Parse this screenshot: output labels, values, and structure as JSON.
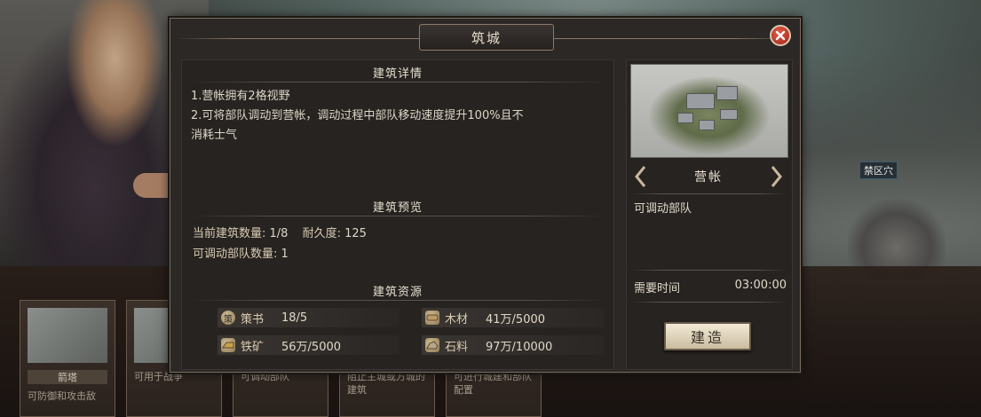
{
  "dialog": {
    "title": "筑城"
  },
  "details": {
    "heading": "建筑详情",
    "lines": [
      "1.营帐拥有2格视野",
      "2.可将部队调动到营帐，调动过程中部队移动速度提升100%且不",
      "消耗士气"
    ]
  },
  "preview": {
    "heading": "建筑预览",
    "build_count_label": "当前建筑数量:",
    "build_count_value": "1/8",
    "durability_label": "耐久度:",
    "durability_value": "125",
    "troop_count_label": "可调动部队数量:",
    "troop_count_value": "1"
  },
  "resources": {
    "heading": "建筑资源",
    "items": [
      {
        "icon": "strategy-book-icon",
        "glyph": "策",
        "name": "策书",
        "value": "18/5"
      },
      {
        "icon": "wood-icon",
        "glyph": "",
        "name": "木材",
        "value": "41万/5000"
      },
      {
        "icon": "iron-icon",
        "glyph": "",
        "name": "铁矿",
        "value": "56万/5000"
      },
      {
        "icon": "stone-icon",
        "glyph": "",
        "name": "石料",
        "value": "97万/10000"
      }
    ]
  },
  "building": {
    "name": "营帐",
    "function": "可调动部队",
    "time_label": "需要时间",
    "time_value": "03:00:00",
    "build_button": "建造"
  },
  "background": {
    "cards": [
      {
        "name": "箭塔",
        "desc": "可防御和攻击敌"
      },
      {
        "name": "",
        "desc": "可用于战争"
      },
      {
        "name": "",
        "desc": "可调动部队"
      },
      {
        "name": "",
        "desc": "阻止主城或方城的建筑"
      },
      {
        "name": "",
        "desc": "可进行城建和部队配置"
      }
    ],
    "map_label": "禁区穴"
  },
  "colors": {
    "close_button": "#c0392b",
    "panel": "#262321",
    "accent_gold": "#c8b89a"
  }
}
